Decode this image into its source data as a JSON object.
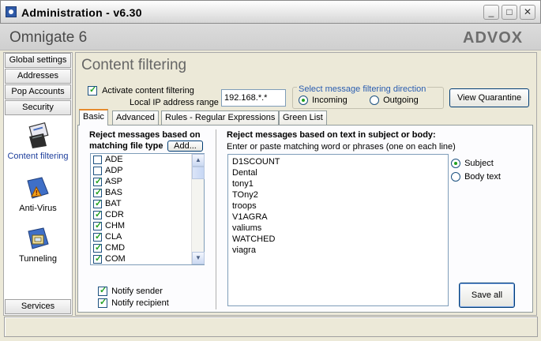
{
  "window": {
    "title": "Administration - v6.30",
    "minimize": "_",
    "maximize": "□",
    "close": "✕"
  },
  "header": {
    "product": "Omnigate 6",
    "vendor": "ADVOX"
  },
  "nav": {
    "buttons": [
      "Global settings",
      "Addresses",
      "Pop Accounts",
      "Security"
    ],
    "items": [
      {
        "label": "Content filtering",
        "icon": "content-filter-icon"
      },
      {
        "label": "Anti-Virus",
        "icon": "antivirus-icon"
      },
      {
        "label": "Tunneling",
        "icon": "tunneling-icon"
      }
    ],
    "bottom_button": "Services"
  },
  "page": {
    "title": "Content filtering",
    "activate_label": "Activate content filtering",
    "activate_checked": true,
    "local_ip_label": "Local IP address range",
    "local_ip_value": "192.168.*.*",
    "direction": {
      "legend": "Select message filtering direction",
      "incoming": "Incoming",
      "outgoing": "Outgoing",
      "selected": "Incoming"
    },
    "view_quarantine": "View Quarantine"
  },
  "tabs": [
    {
      "label": "Basic",
      "active": true
    },
    {
      "label": "Advanced",
      "active": false
    },
    {
      "label": "Rules - Regular Expressions",
      "active": false
    },
    {
      "label": "Green List",
      "active": false
    }
  ],
  "basic": {
    "filetype_heading_1": "Reject messages based on",
    "filetype_heading_2": "matching file type",
    "add_button": "Add...",
    "file_types": [
      {
        "ext": "ADE",
        "checked": false
      },
      {
        "ext": "ADP",
        "checked": false
      },
      {
        "ext": "ASP",
        "checked": true
      },
      {
        "ext": "BAS",
        "checked": true
      },
      {
        "ext": "BAT",
        "checked": true
      },
      {
        "ext": "CDR",
        "checked": true
      },
      {
        "ext": "CHM",
        "checked": true
      },
      {
        "ext": "CLA",
        "checked": true
      },
      {
        "ext": "CMD",
        "checked": true
      },
      {
        "ext": "COM",
        "checked": true
      }
    ],
    "notify_sender": "Notify sender",
    "notify_sender_checked": true,
    "notify_recipient": "Notify recipient",
    "notify_recipient_checked": true,
    "text_heading": "Reject messages based on text in subject or body:",
    "text_subheading": "Enter or paste matching word or phrases (one on each line)",
    "words": [
      "D1SCOUNT",
      "Dental",
      "tony1",
      "TOny2",
      "troops",
      "V1AGRA",
      "valiums",
      "WATCHED",
      "viagra"
    ],
    "scope_subject": "Subject",
    "scope_body": "Body text",
    "scope_selected": "Subject",
    "save_all": "Save all"
  },
  "colors": {
    "accent_tab": "#e68b2c",
    "check": "#21a121",
    "legend": "#2a5db0"
  }
}
